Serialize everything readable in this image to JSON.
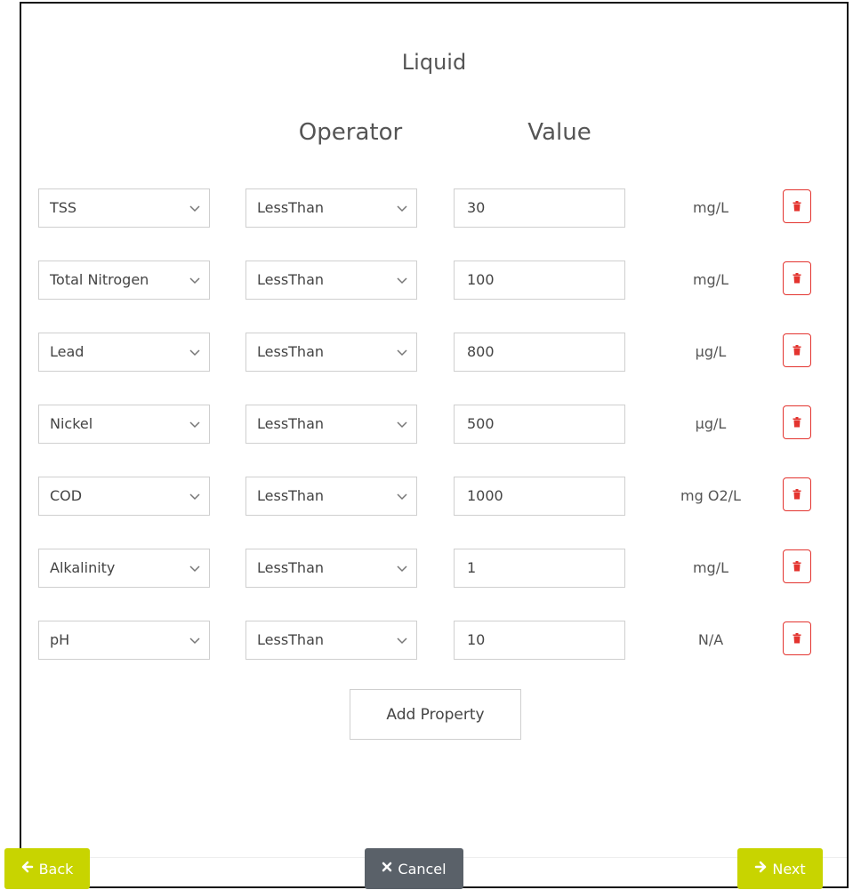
{
  "section_title": "Liquid",
  "columns": {
    "operator": "Operator",
    "value": "Value"
  },
  "rows": [
    {
      "property": "TSS",
      "operator": "LessThan",
      "value": "30",
      "unit": "mg/L"
    },
    {
      "property": "Total Nitrogen",
      "operator": "LessThan",
      "value": "100",
      "unit": "mg/L"
    },
    {
      "property": "Lead",
      "operator": "LessThan",
      "value": "800",
      "unit": "µg/L"
    },
    {
      "property": "Nickel",
      "operator": "LessThan",
      "value": "500",
      "unit": "µg/L"
    },
    {
      "property": "COD",
      "operator": "LessThan",
      "value": "1000",
      "unit": "mg O2/L"
    },
    {
      "property": "Alkalinity",
      "operator": "LessThan",
      "value": "1",
      "unit": "mg/L"
    },
    {
      "property": "pH",
      "operator": "LessThan",
      "value": "10",
      "unit": "N/A"
    }
  ],
  "add_property_label": "Add Property",
  "footer": {
    "back_label": "Back",
    "cancel_label": "Cancel",
    "next_label": "Next"
  },
  "colors": {
    "accent": "#c8d400",
    "cancel": "#5a6169",
    "danger": "#e3342f"
  },
  "icons": {
    "chevron": "chevron-down-icon",
    "delete": "trash-icon",
    "back": "arrow-left-icon",
    "cancel": "x-icon",
    "next": "arrow-right-icon"
  }
}
